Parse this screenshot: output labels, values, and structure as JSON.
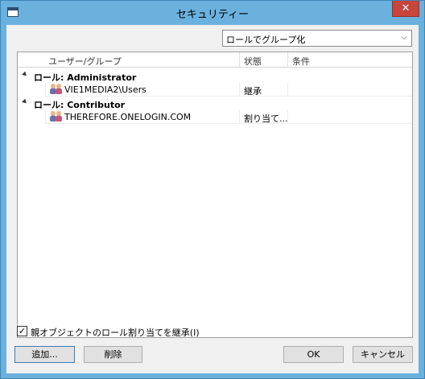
{
  "window": {
    "title": "セキュリティー",
    "close_glyph": "✕"
  },
  "grouping": {
    "selected": "ロールでグループ化"
  },
  "table": {
    "columns": [
      "ユーザー/グループ",
      "状態",
      "条件"
    ],
    "groups": [
      {
        "label": "ロール: Administrator",
        "rows": [
          {
            "name": "VIE1MEDIA2\\Users",
            "status": "継承",
            "condition": ""
          }
        ]
      },
      {
        "label": "ロール: Contributor",
        "rows": [
          {
            "name": "THEREFORE.ONELOGIN.COM",
            "status": "割り当て...",
            "condition": ""
          }
        ]
      }
    ]
  },
  "inherit": {
    "checked": true,
    "check_glyph": "✓",
    "label": "親オブジェクトのロール割り当てを継承(I)"
  },
  "buttons": {
    "add": "追加...",
    "delete": "削除",
    "ok": "OK",
    "cancel": "キャンセル"
  }
}
